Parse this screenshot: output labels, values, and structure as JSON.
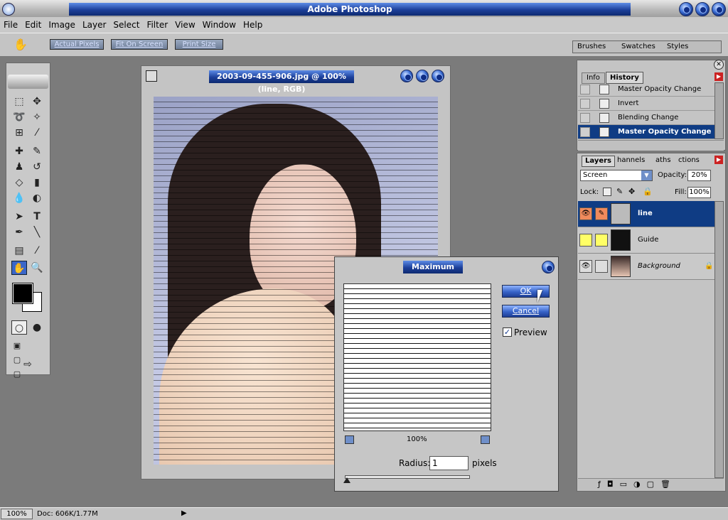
{
  "app": {
    "title": "Adobe Photoshop"
  },
  "menu": {
    "items": [
      "File",
      "Edit",
      "Image",
      "Layer",
      "Select",
      "Filter",
      "View",
      "Window",
      "Help"
    ]
  },
  "options": {
    "actual_pixels": "Actual Pixels",
    "fit_on_screen": "Fit On Screen",
    "print_size": "Print Size"
  },
  "palette_well": {
    "tabs": [
      "Brushes",
      "Swatches",
      "Styles"
    ]
  },
  "document": {
    "title": "2003-09-455-906.jpg @ 100% (line, RGB)"
  },
  "dialog": {
    "title": "Maximum",
    "ok_label": "OK",
    "cancel_label": "Cancel",
    "preview_label": "Preview",
    "preview_checked": true,
    "zoom": "100%",
    "radius_label": "Radius:",
    "radius_value": "1",
    "radius_unit": "pixels"
  },
  "history_panel": {
    "tabs": [
      "Info",
      "History"
    ],
    "active_tab": "History",
    "items": [
      "Master Opacity Change",
      "Invert",
      "Blending Change",
      "Master Opacity Change"
    ],
    "selected_index": 3
  },
  "layers_panel": {
    "tabs": [
      "Layers",
      "Channels",
      "Paths",
      "Actions"
    ],
    "tab_labels_visible": [
      "Layers",
      "hannels",
      "aths",
      "ctions"
    ],
    "blend_mode": "Screen",
    "opacity_label": "Opacity:",
    "opacity_value": "20%",
    "lock_label": "Lock:",
    "fill_label": "Fill:",
    "fill_value": "100%",
    "layers": [
      {
        "name": "line",
        "selected": true
      },
      {
        "name": "Guide",
        "selected": false
      },
      {
        "name": "Background",
        "selected": false
      }
    ]
  },
  "status_bar": {
    "zoom": "100%",
    "doc_info": "Doc: 606K/1.77M"
  },
  "colors": {
    "accent_blue": "#0f3c84",
    "layer_orange": "#f08a5c",
    "layer_yellow": "#ffff66"
  }
}
